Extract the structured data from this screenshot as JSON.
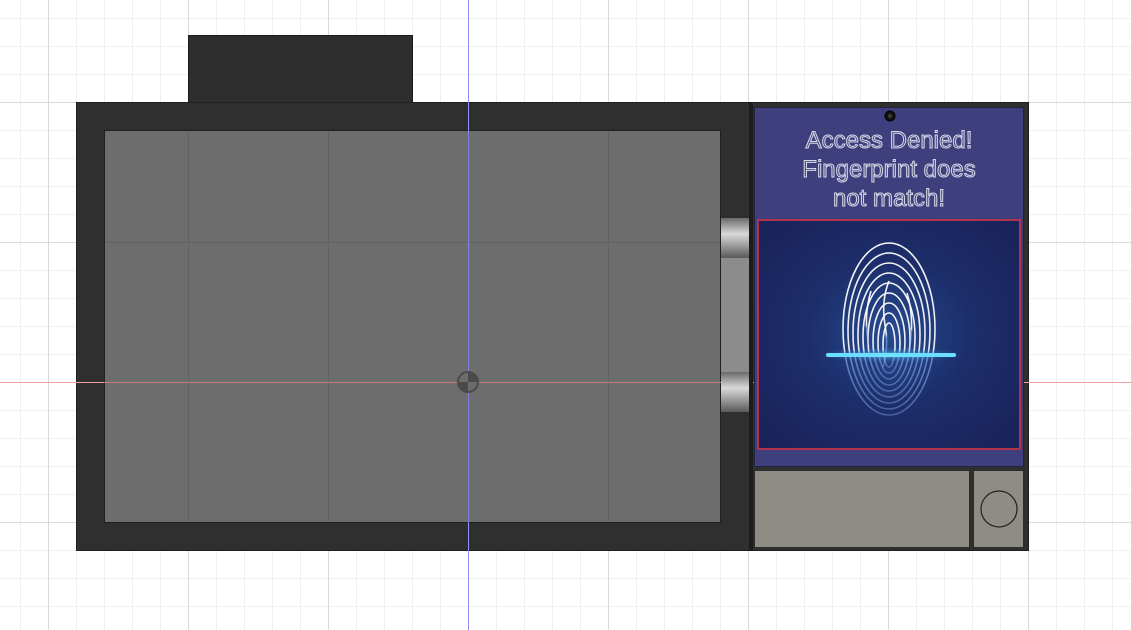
{
  "viewport": {
    "name": "CAD front view of fingerprint access device",
    "background": "#ffffff"
  },
  "device": {
    "housing_color": "#2f2f2f",
    "cavity_color": "#6d6d6d",
    "screen": {
      "background": "#3e3f7c",
      "message": {
        "line1": "Access Denied!",
        "line2": "Fingerprint does",
        "line3": "not match!"
      },
      "fingerprint_icon": "fingerprint-scan-icon",
      "scan_line_color": "#5fd8ff",
      "panel_border_color": "#b2334c"
    },
    "buttons": {
      "rect_button_icon": "rectangular-button",
      "round_button_icon": "circle-button-icon"
    }
  },
  "axes": {
    "vertical_color": "#8f8ff5",
    "horizontal_color": "#f1a0a0"
  }
}
